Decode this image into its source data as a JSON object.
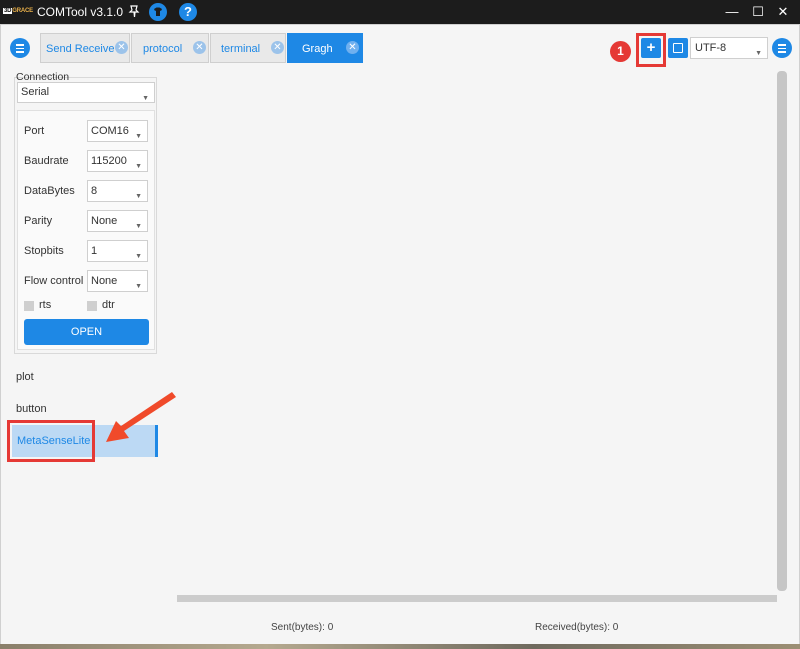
{
  "window": {
    "title": "COMTool v3.1.0",
    "logo_text_a": "3D",
    "logo_text_b": "GRACE",
    "minimize_glyph": "—",
    "maximize_glyph": "☐",
    "close_glyph": "✕",
    "help_glyph": "?"
  },
  "tabs": [
    {
      "label": "Send Receive",
      "active": false
    },
    {
      "label": "protocol",
      "active": false
    },
    {
      "label": "terminal",
      "active": false
    },
    {
      "label": "Gragh",
      "active": true
    }
  ],
  "toolbar": {
    "add_glyph": "+",
    "encoding": "UTF-8",
    "annotation_number": "1"
  },
  "connection": {
    "title": "Connection",
    "type": "Serial",
    "params": [
      {
        "label": "Port",
        "value": "COM16"
      },
      {
        "label": "Baudrate",
        "value": "115200"
      },
      {
        "label": "DataBytes",
        "value": "8"
      },
      {
        "label": "Parity",
        "value": "None"
      },
      {
        "label": "Stopbits",
        "value": "1"
      },
      {
        "label": "Flow control",
        "value": "None"
      }
    ],
    "rts_label": "rts",
    "dtr_label": "dtr",
    "open_label": "OPEN"
  },
  "plugins": {
    "items": [
      "plot",
      "button",
      "MetaSenseLite"
    ],
    "selected": "MetaSenseLite"
  },
  "status": {
    "sent": "Sent(bytes): 0",
    "received": "Received(bytes): 0"
  },
  "colors": {
    "accent": "#1e88e5",
    "annotation_red": "#e53935",
    "selected_row": "#bcd9f4"
  }
}
